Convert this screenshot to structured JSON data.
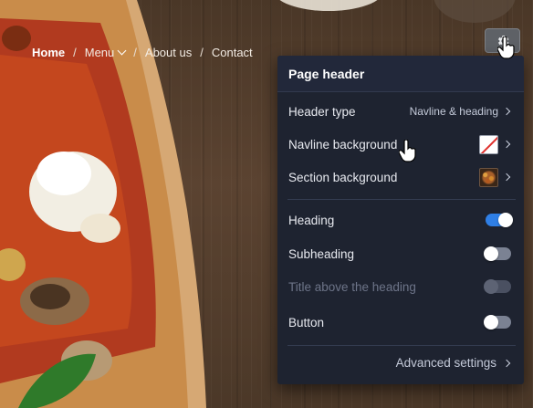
{
  "nav": {
    "items": [
      {
        "label": "Home"
      },
      {
        "label": "Menu"
      },
      {
        "label": "About us"
      },
      {
        "label": "Contact"
      }
    ],
    "separator": "/"
  },
  "gear_button": {
    "icon": "gear-icon"
  },
  "panel": {
    "title": "Page header",
    "header_type": {
      "label": "Header type",
      "value": "Navline & heading"
    },
    "navline_background": {
      "label": "Navline background",
      "swatch": "none"
    },
    "section_background": {
      "label": "Section background",
      "swatch": "image"
    },
    "toggles": [
      {
        "label": "Heading",
        "state": "on"
      },
      {
        "label": "Subheading",
        "state": "off"
      },
      {
        "label": "Title above the heading",
        "state": "disabled"
      },
      {
        "label": "Button",
        "state": "off"
      }
    ],
    "advanced_label": "Advanced settings"
  },
  "colors": {
    "panel_bg": "#1e2330",
    "toggle_on": "#2f7fe6",
    "toggle_off": "#7b8293"
  }
}
